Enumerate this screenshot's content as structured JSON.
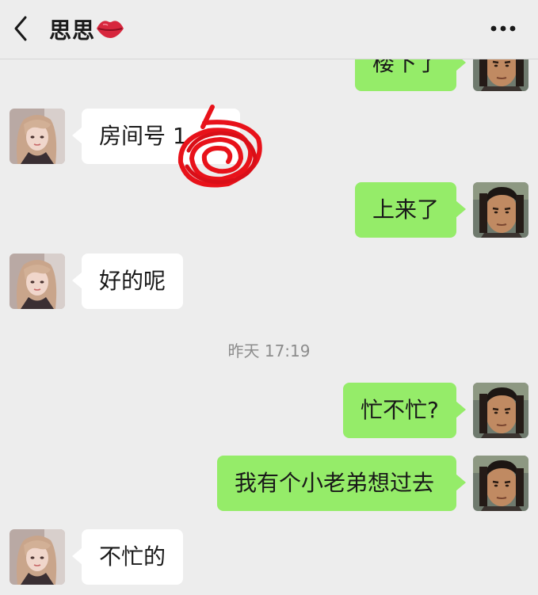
{
  "header": {
    "title": "思思",
    "back_icon": "chevron-left-icon",
    "title_emoji": "kiss-lips-icon",
    "more_icon": "ellipsis-icon"
  },
  "chat": {
    "messages": [
      {
        "side": "out",
        "text": "楼下了"
      },
      {
        "side": "in",
        "text": "房间号 1"
      },
      {
        "side": "out",
        "text": "上来了"
      },
      {
        "side": "in",
        "text": "好的呢"
      },
      {
        "side": "out",
        "text": "忙不忙?"
      },
      {
        "side": "out",
        "text": "我有个小老弟想过去"
      },
      {
        "side": "in",
        "text": "不忙的"
      }
    ],
    "timestamp": "昨天 17:19",
    "redaction_color": "#e8121a"
  },
  "colors": {
    "background": "#ededed",
    "outgoing_bubble": "#95ec69",
    "incoming_bubble": "#ffffff"
  }
}
